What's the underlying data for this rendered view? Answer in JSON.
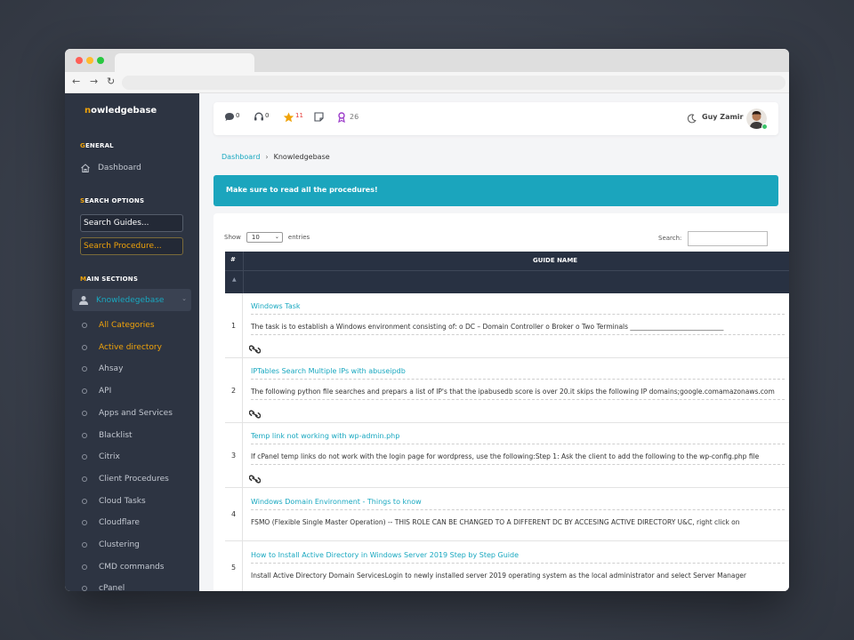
{
  "sidebar": {
    "brand_initial": "n",
    "brand_rest": "owledgebase",
    "general_initial": "G",
    "general_rest": "ENERAL",
    "dashboard_label": "Dashboard",
    "search_initial": "S",
    "search_rest": "EARCH OPTIONS",
    "search_guides_value": "Search Guides...",
    "search_procedures_value": "Search Procedure...",
    "main_initial": "M",
    "main_rest": "AIN SECTIONS",
    "kb_label": "Knowledegebase",
    "categories": [
      {
        "label": "All Categories"
      },
      {
        "label": "Active directory"
      },
      {
        "label": "Ahsay"
      },
      {
        "label": "API"
      },
      {
        "label": "Apps and Services"
      },
      {
        "label": "Blacklist"
      },
      {
        "label": "Citrix"
      },
      {
        "label": "Client Procedures"
      },
      {
        "label": "Cloud Tasks"
      },
      {
        "label": "Cloudflare"
      },
      {
        "label": "Clustering"
      },
      {
        "label": "CMD commands"
      },
      {
        "label": "cPanel"
      }
    ]
  },
  "topbar": {
    "messages_count": "0",
    "support_count": "0",
    "star_count": "11",
    "xp_value": "26",
    "user_name": "Guy Zamir"
  },
  "breadcrumb": {
    "root": "Dashboard",
    "current": "Knowledgebase"
  },
  "alert": {
    "text": "Make sure to read all the procedures!"
  },
  "table": {
    "show_label": "Show",
    "show_value": "10",
    "entries_label": "entries",
    "search_label": "Search:",
    "col_hash": "#",
    "col_guide": "GUIDE NAME",
    "rows": [
      {
        "num": "1",
        "title": "Windows Task",
        "desc": "The task is to establish a Windows environment consisting of: o DC – Domain Controller o Broker o Two Terminals ____________________________"
      },
      {
        "num": "2",
        "title": "IPTables Search Multiple IPs with abuseipdb",
        "desc": "The following python file searches and prepars a list of IP's that the ipabusedb score is over 20.it skips the following IP domains;google.comamazonaws.com"
      },
      {
        "num": "3",
        "title": "Temp link not working with wp-admin.php",
        "desc": "If cPanel temp links do not work with the login page for wordpress, use the following:Step 1: Ask the client to add the following to the wp-config.php file"
      },
      {
        "num": "4",
        "title": "Windows Domain Environment - Things to know",
        "desc": "FSMO (Flexible Single Master Operation) -- THIS ROLE CAN BE CHANGED TO A DIFFERENT DC BY ACCESING ACTIVE DIRECTORY U&C, right click on"
      },
      {
        "num": "5",
        "title": "How to Install Active Directory in Windows Server 2019 Step by Step Guide",
        "desc": "Install Active Directory Domain ServicesLogin to newly installed server 2019 operating system as the local administrator and select Server Manager"
      }
    ]
  }
}
